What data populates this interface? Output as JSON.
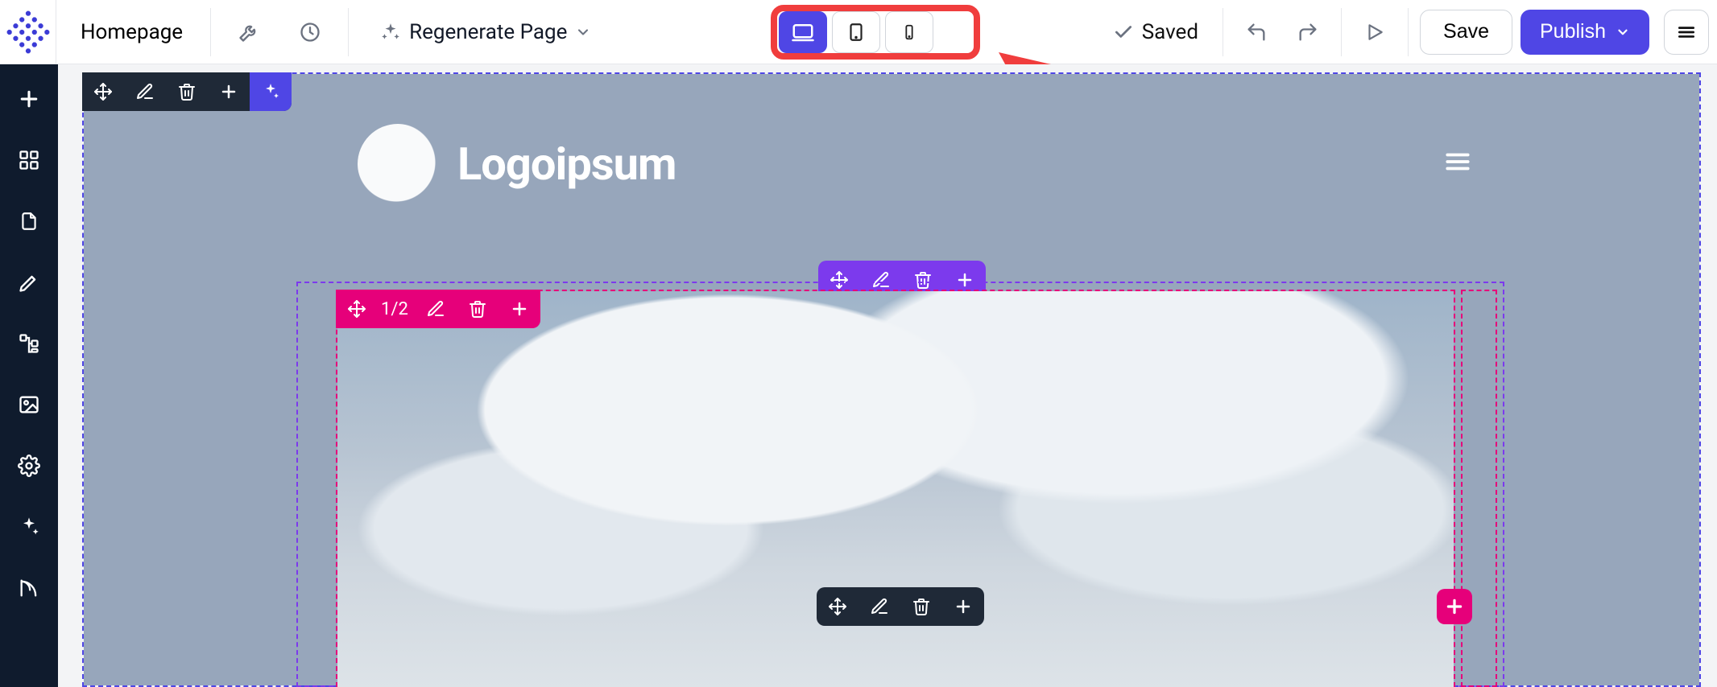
{
  "toolbar": {
    "page_title": "Homepage",
    "regenerate_label": "Regenerate Page",
    "saved_label": "Saved",
    "save_label": "Save",
    "publish_label": "Publish"
  },
  "devices": {
    "active": "desktop",
    "options": [
      "desktop",
      "tablet",
      "mobile"
    ]
  },
  "sidebar": {
    "items": [
      {
        "name": "add",
        "icon": "plus"
      },
      {
        "name": "blocks",
        "icon": "grid"
      },
      {
        "name": "pages",
        "icon": "page"
      },
      {
        "name": "design",
        "icon": "pen"
      },
      {
        "name": "structure",
        "icon": "tree"
      },
      {
        "name": "media",
        "icon": "image"
      },
      {
        "name": "settings",
        "icon": "gear"
      },
      {
        "name": "ai",
        "icon": "sparkle"
      },
      {
        "name": "blog",
        "icon": "blog"
      }
    ]
  },
  "canvas": {
    "hero": {
      "brand_text": "Logoipsum"
    },
    "column_toolbar": {
      "index_label": "1/2"
    }
  },
  "annotation": {
    "highlight_target": "device-switcher",
    "arrow": true
  },
  "colors": {
    "accent": "#4f46e5",
    "pink": "#e6007a",
    "purple": "#7c3aed",
    "sidebar_bg": "#0f1b2d",
    "highlight": "#f03d3d"
  }
}
